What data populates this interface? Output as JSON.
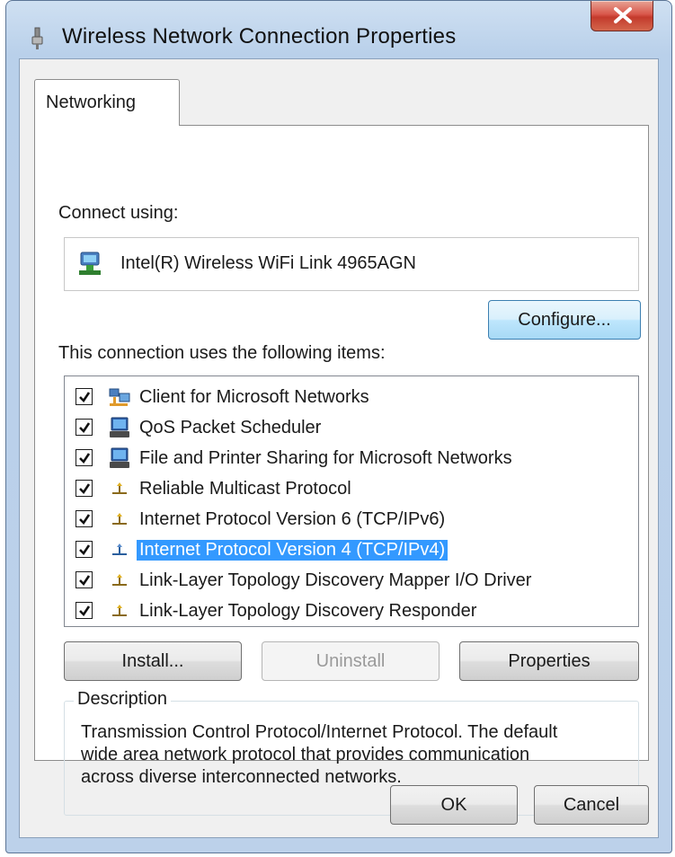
{
  "window": {
    "title": "Wireless Network Connection Properties"
  },
  "tabs": [
    {
      "label": "Networking"
    }
  ],
  "connect_using": {
    "label": "Connect using:",
    "adapter_name": "Intel(R) Wireless WiFi Link 4965AGN",
    "configure_label": "Configure..."
  },
  "items_section": {
    "label": "This connection uses the following items:",
    "items": [
      {
        "label": "Client for Microsoft Networks",
        "checked": true,
        "icon": "network-client-icon"
      },
      {
        "label": "QoS Packet Scheduler",
        "checked": true,
        "icon": "computer-icon"
      },
      {
        "label": "File and Printer Sharing for Microsoft Networks",
        "checked": true,
        "icon": "computer-icon"
      },
      {
        "label": "Reliable Multicast Protocol",
        "checked": true,
        "icon": "protocol-icon"
      },
      {
        "label": "Internet Protocol Version 6 (TCP/IPv6)",
        "checked": true,
        "icon": "protocol-icon"
      },
      {
        "label": "Internet Protocol Version 4 (TCP/IPv4)",
        "checked": true,
        "icon": "protocol-icon",
        "selected": true
      },
      {
        "label": "Link-Layer Topology Discovery Mapper I/O Driver",
        "checked": true,
        "icon": "protocol-icon"
      },
      {
        "label": "Link-Layer Topology Discovery Responder",
        "checked": true,
        "icon": "protocol-icon"
      }
    ]
  },
  "buttons": {
    "install": "Install...",
    "uninstall": "Uninstall",
    "properties": "Properties",
    "ok": "OK",
    "cancel": "Cancel"
  },
  "description": {
    "legend": "Description",
    "lines": [
      "Transmission Control Protocol/Internet Protocol. The default",
      "wide area network protocol that provides communication",
      "across diverse interconnected networks."
    ]
  },
  "colors": {
    "selection": "#3399ff",
    "close_button": "#c33a2c",
    "frame": "#bcd1ea"
  }
}
